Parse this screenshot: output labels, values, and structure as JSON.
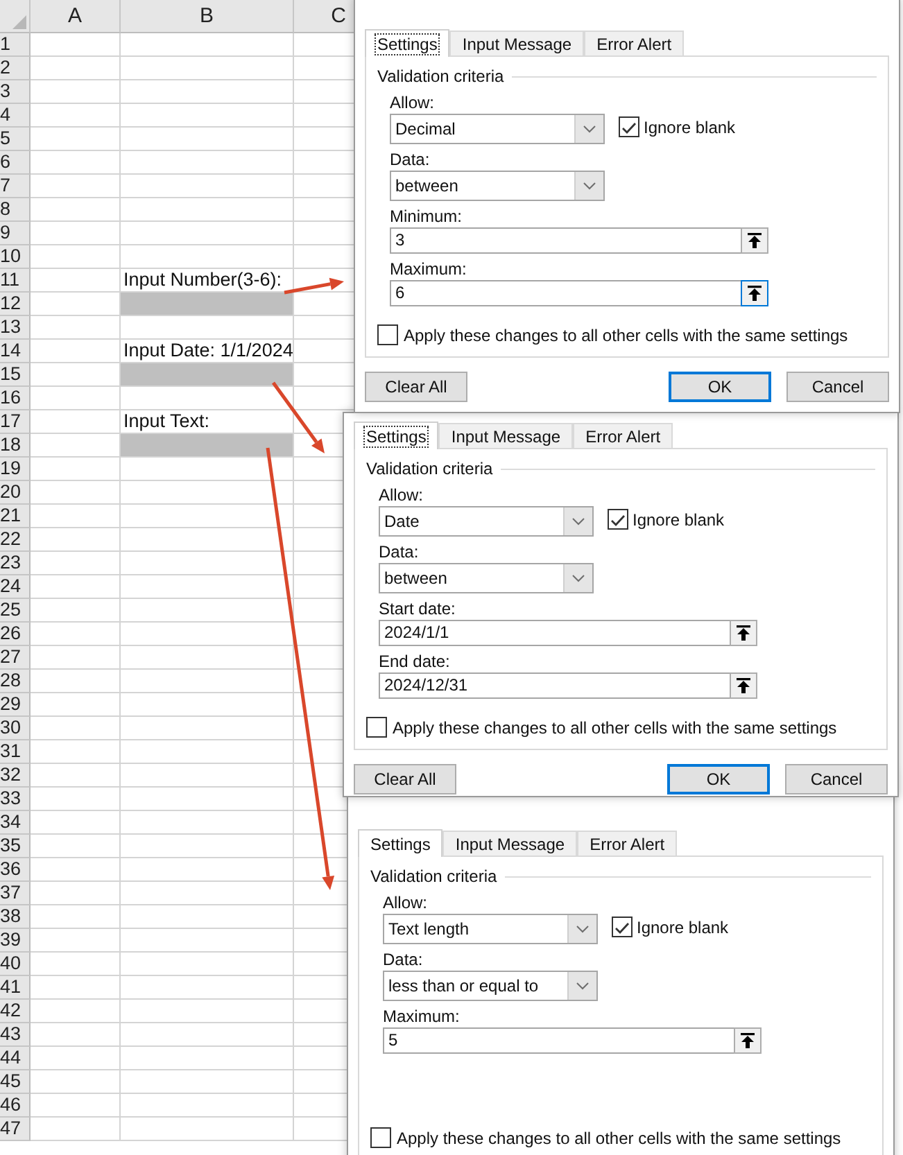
{
  "sheet": {
    "columns": [
      "A",
      "B",
      "C"
    ],
    "rows": [
      {
        "number": "1",
        "shaded": false
      },
      {
        "number": "2",
        "shaded": false
      },
      {
        "number": "3",
        "shaded": false
      },
      {
        "number": "4",
        "shaded": false
      },
      {
        "number": "5",
        "shaded": false
      },
      {
        "number": "6",
        "shaded": false
      },
      {
        "number": "7",
        "shaded": false
      },
      {
        "number": "8",
        "shaded": false
      },
      {
        "number": "9",
        "shaded": false
      },
      {
        "number": "10",
        "shaded": false
      },
      {
        "number": "11",
        "b": "Input Number(3-6):",
        "shaded": false
      },
      {
        "number": "12",
        "shaded": true
      },
      {
        "number": "13",
        "shaded": false
      },
      {
        "number": "14",
        "b": "Input Date: 1/1/2024",
        "shaded": false
      },
      {
        "number": "15",
        "shaded": true
      },
      {
        "number": "16",
        "shaded": false
      },
      {
        "number": "17",
        "b": "Input Text:",
        "shaded": false
      },
      {
        "number": "18",
        "shaded": true
      },
      {
        "number": "19",
        "shaded": false
      },
      {
        "number": "20",
        "shaded": false
      },
      {
        "number": "21",
        "shaded": false
      },
      {
        "number": "22",
        "shaded": false
      },
      {
        "number": "23",
        "shaded": false
      },
      {
        "number": "24",
        "shaded": false
      },
      {
        "number": "25",
        "shaded": false
      },
      {
        "number": "26",
        "shaded": false
      },
      {
        "number": "27",
        "shaded": false
      },
      {
        "number": "28",
        "shaded": false
      },
      {
        "number": "29",
        "shaded": false
      },
      {
        "number": "30",
        "shaded": false
      },
      {
        "number": "31",
        "shaded": false
      },
      {
        "number": "32",
        "shaded": false
      },
      {
        "number": "33",
        "shaded": false
      },
      {
        "number": "34",
        "shaded": false
      },
      {
        "number": "35",
        "shaded": false
      },
      {
        "number": "36",
        "shaded": false
      },
      {
        "number": "37",
        "shaded": false
      },
      {
        "number": "38",
        "shaded": false
      },
      {
        "number": "39",
        "shaded": false
      },
      {
        "number": "40",
        "shaded": false
      },
      {
        "number": "41",
        "shaded": false
      },
      {
        "number": "42",
        "shaded": false
      },
      {
        "number": "43",
        "shaded": false
      },
      {
        "number": "44",
        "shaded": false
      },
      {
        "number": "45",
        "shaded": false
      },
      {
        "number": "46",
        "shaded": false
      },
      {
        "number": "47",
        "shaded": false
      }
    ]
  },
  "dialogs": [
    {
      "tabs": [
        {
          "label": "Settings",
          "selected": true,
          "focused": true
        },
        {
          "label": "Input Message",
          "selected": false,
          "focused": false
        },
        {
          "label": "Error Alert",
          "selected": false,
          "focused": false
        }
      ],
      "group_title": "Validation criteria",
      "allow": {
        "label": "Allow:",
        "value": "Decimal"
      },
      "ignore_blank": {
        "label": "Ignore blank",
        "checked": true
      },
      "data": {
        "label": "Data:",
        "value": "between"
      },
      "fields": [
        {
          "label": "Minimum:",
          "value": "3",
          "button_focused": false
        },
        {
          "label": "Maximum:",
          "value": "6",
          "button_focused": true
        }
      ],
      "apply": {
        "label": "Apply these changes to all other cells with the same settings",
        "checked": false
      },
      "buttons": [
        {
          "label": "Clear All",
          "default": false
        },
        {
          "label": "OK",
          "default": true
        },
        {
          "label": "Cancel",
          "default": false
        }
      ]
    },
    {
      "tabs": [
        {
          "label": "Settings",
          "selected": true,
          "focused": true
        },
        {
          "label": "Input Message",
          "selected": false,
          "focused": false
        },
        {
          "label": "Error Alert",
          "selected": false,
          "focused": false
        }
      ],
      "group_title": "Validation criteria",
      "allow": {
        "label": "Allow:",
        "value": "Date"
      },
      "ignore_blank": {
        "label": "Ignore blank",
        "checked": true
      },
      "data": {
        "label": "Data:",
        "value": "between"
      },
      "fields": [
        {
          "label": "Start date:",
          "value": "2024/1/1",
          "button_focused": false
        },
        {
          "label": "End date:",
          "value": "2024/12/31",
          "button_focused": false
        }
      ],
      "apply": {
        "label": "Apply these changes to all other cells with the same settings",
        "checked": false
      },
      "buttons": [
        {
          "label": "Clear All",
          "default": false
        },
        {
          "label": "OK",
          "default": true
        },
        {
          "label": "Cancel",
          "default": false
        }
      ]
    },
    {
      "tabs": [
        {
          "label": "Settings",
          "selected": true,
          "focused": false
        },
        {
          "label": "Input Message",
          "selected": false,
          "focused": false
        },
        {
          "label": "Error Alert",
          "selected": false,
          "focused": false
        }
      ],
      "group_title": "Validation criteria",
      "allow": {
        "label": "Allow:",
        "value": "Text length"
      },
      "ignore_blank": {
        "label": "Ignore blank",
        "checked": true
      },
      "data": {
        "label": "Data:",
        "value": "less than or equal to"
      },
      "fields": [
        {
          "label": "Maximum:",
          "value": "5",
          "button_focused": false
        }
      ],
      "apply": {
        "label": "Apply these changes to all other cells with the same settings",
        "checked": false
      }
    }
  ]
}
